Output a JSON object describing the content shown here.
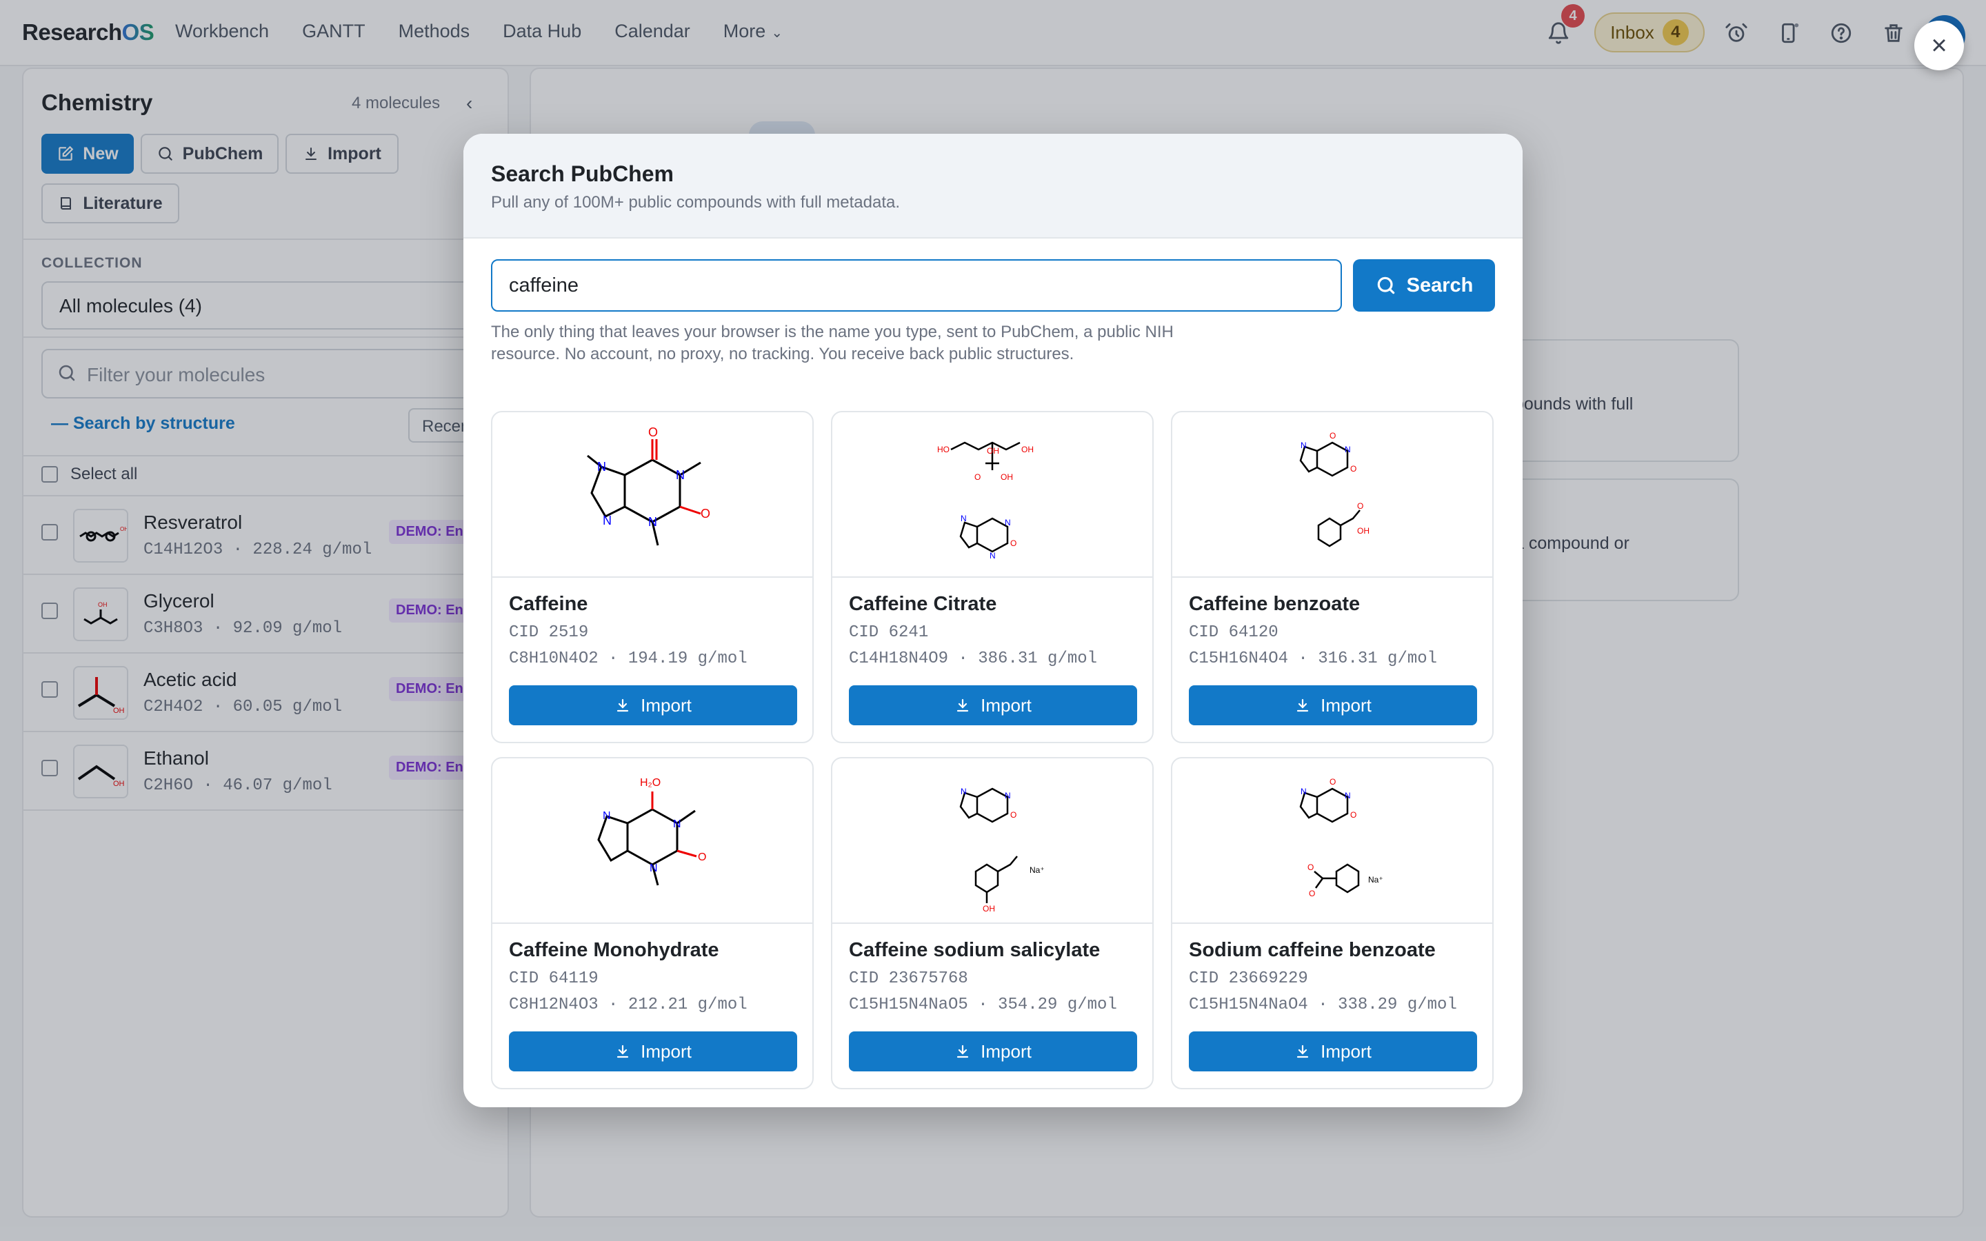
{
  "app": {
    "logo_main": "Research",
    "logo_accent": "OS",
    "nav": [
      "Workbench",
      "GANTT",
      "Methods",
      "Data Hub",
      "Calendar",
      "More"
    ],
    "notification_count": "4",
    "inbox_label": "Inbox",
    "inbox_count": "4",
    "icons": [
      "bell-icon",
      "alarm-clock-icon",
      "phone-icon",
      "help-icon",
      "trash-icon",
      "close-icon"
    ]
  },
  "sidebar": {
    "title": "Chemistry",
    "count": "4 molecules",
    "buttons": {
      "new": "New",
      "pubchem": "PubChem",
      "import": "Import",
      "literature": "Literature"
    },
    "collection_label": "COLLECTION",
    "collection_value": "All molecules (4)",
    "filter_placeholder": "Filter your molecules",
    "structure_search": "Search by structure",
    "recent": "Recen",
    "select_all": "Select all",
    "molecules": [
      {
        "name": "Resveratrol",
        "formula": "C14H12O3  ·  228.24 g/mol",
        "tag": "DEMO: En"
      },
      {
        "name": "Glycerol",
        "formula": "C3H8O3  ·  92.09 g/mol",
        "tag": "DEMO: En"
      },
      {
        "name": "Acetic acid",
        "formula": "C2H4O2  ·  60.05 g/mol",
        "tag": "DEMO: En"
      },
      {
        "name": "Ethanol",
        "formula": "C2H6O  ·  46.07 g/mol",
        "tag": "DEMO: En"
      }
    ]
  },
  "background": {
    "card1_text": "pounds with full",
    "card2_text": "a compound or"
  },
  "modal": {
    "title": "Search PubChem",
    "subtitle": "Pull any of 100M+ public compounds with full metadata.",
    "search_value": "caffeine",
    "search_button": "Search",
    "disclaimer": "The only thing that leaves your browser is the name you type, sent to PubChem, a public NIH resource. No account, no proxy, no tracking. You receive back public structures.",
    "import_label": "Import",
    "results": [
      {
        "name": "Caffeine",
        "cid": "CID 2519",
        "formula": "C8H10N4O2  ·  194.19 g/mol"
      },
      {
        "name": "Caffeine Citrate",
        "cid": "CID 6241",
        "formula": "C14H18N4O9  ·  386.31 g/mol"
      },
      {
        "name": "Caffeine benzoate",
        "cid": "CID 64120",
        "formula": "C15H16N4O4  ·  316.31 g/mol"
      },
      {
        "name": "Caffeine Monohydrate",
        "cid": "CID 64119",
        "formula": "C8H12N4O3  ·  212.21 g/mol"
      },
      {
        "name": "Caffeine sodium salicylate",
        "cid": "CID 23675768",
        "formula": "C15H15N4NaO5  ·  354.29 g/mol"
      },
      {
        "name": "Sodium caffeine benzoate",
        "cid": "CID 23669229",
        "formula": "C15H15N4NaO4  ·  338.29 g/mol"
      }
    ],
    "structure_labels": {
      "oh": "OH",
      "ho": "HO",
      "o": "O",
      "n": "N",
      "water": "H₂O",
      "na": "Na⁺"
    }
  }
}
